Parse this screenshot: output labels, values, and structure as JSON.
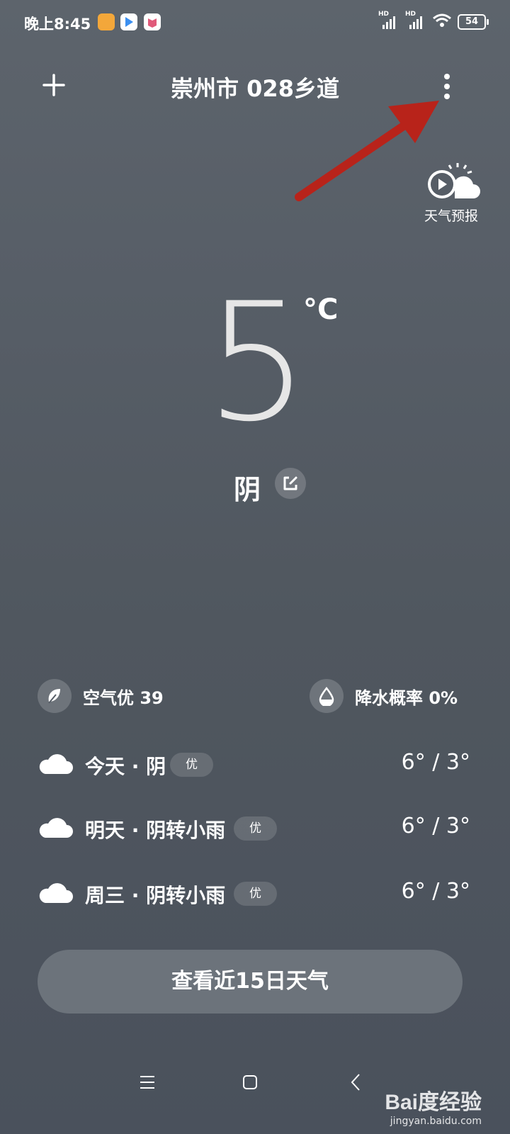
{
  "status_bar": {
    "time": "晚上8:45",
    "network_1": "HD",
    "network_2": "HD",
    "battery": "54"
  },
  "header": {
    "add_icon": "plus-icon",
    "city": "崇州市 028乡道",
    "more_icon": "more-vert-icon"
  },
  "forecast_video": {
    "label": "天气预报"
  },
  "current": {
    "temperature": "5",
    "unit": "°C",
    "condition": "阴"
  },
  "metrics": {
    "air_quality": "空气优 39",
    "precipitation": "降水概率 0%"
  },
  "daily": [
    {
      "label": "今天 · 阴",
      "aq": "优",
      "temp": "6° / 3°"
    },
    {
      "label": "明天 · 阴转小雨",
      "aq": "优",
      "temp": "6° / 3°"
    },
    {
      "label": "周三 · 阴转小雨",
      "aq": "优",
      "temp": "6° / 3°"
    }
  ],
  "view_15_days": "查看近15日天气",
  "watermark": {
    "logo": "Bai度经验",
    "url": "jingyan.baidu.com"
  },
  "colors": {
    "annotation_arrow": "#b8231a",
    "button_bg": "#6c737b"
  }
}
